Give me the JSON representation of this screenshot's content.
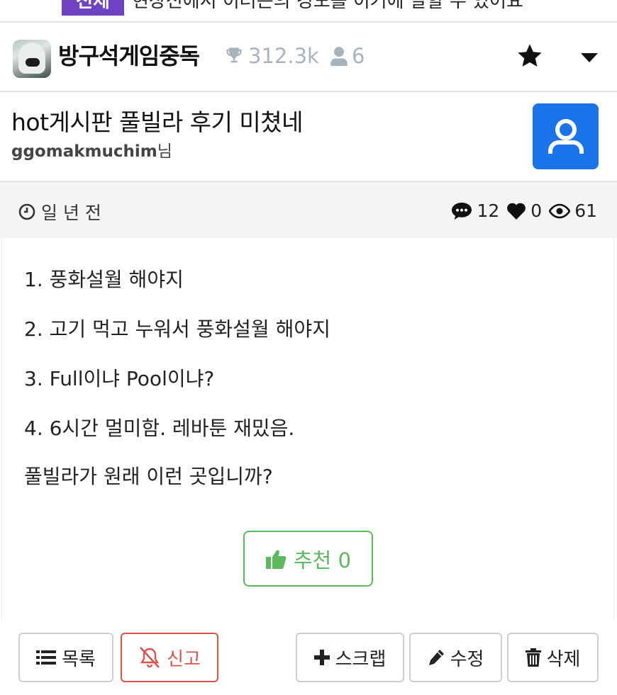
{
  "notice": {
    "badge": "전체",
    "text": "현장전에서 이러는의 경도를 이거에 말할 수 있어요"
  },
  "board": {
    "name": "방구석게임중독",
    "trophy_count": "312.3k",
    "member_count": "6",
    "avatar_icon": "board-avatar",
    "favorite_icon": "star-icon",
    "menu_icon": "caret-down-icon"
  },
  "post": {
    "title": "hot게시판 풀빌라 후기 미쳤네",
    "author_name": "ggomakmuchim",
    "author_suffix": "님",
    "time": "일 년 전",
    "comments": "12",
    "likes": "0",
    "views": "61",
    "body": [
      "1. 풍화설월 해야지",
      "2. 고기 먹고 누워서 풍화설월 해야지",
      "3. Full이냐 Pool이냐?",
      "4. 6시간 멀미함. 레바툰 재밌음.",
      "풀빌라가 원래 이런 곳입니까?"
    ],
    "recommend_label": "추천 0"
  },
  "toolbar": {
    "list": "목록",
    "report": "신고",
    "scrap": "스크랩",
    "edit": "수정",
    "delete": "삭제"
  },
  "colors": {
    "accent_blue": "#1a73e8",
    "recommend_green": "#5cb85c",
    "report_red": "#d9534f",
    "badge_purple": "#6f42c1"
  }
}
